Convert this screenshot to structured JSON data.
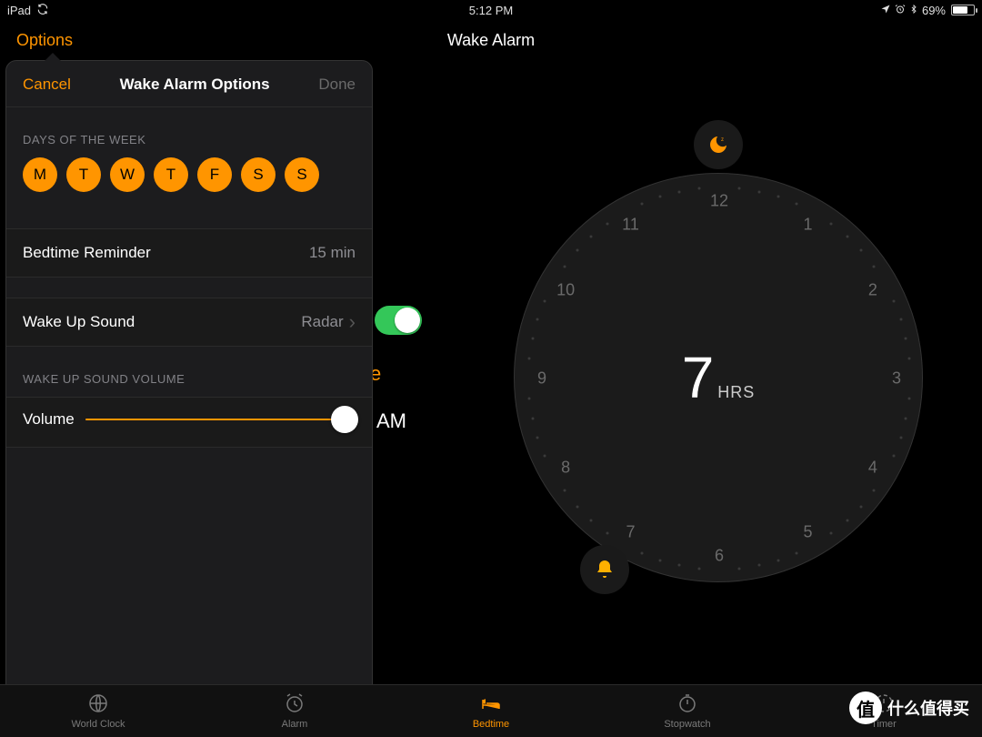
{
  "status": {
    "device": "iPad",
    "time": "5:12 PM",
    "battery_pct": "69%"
  },
  "nav": {
    "options": "Options",
    "title": "Wake Alarm"
  },
  "popover": {
    "cancel": "Cancel",
    "title": "Wake Alarm Options",
    "done": "Done",
    "days_label": "DAYS OF THE WEEK",
    "days": [
      "M",
      "T",
      "W",
      "T",
      "F",
      "S",
      "S"
    ],
    "bedtime_reminder_label": "Bedtime Reminder",
    "bedtime_reminder_value": "15 min",
    "wake_sound_label": "Wake Up Sound",
    "wake_sound_value": "Radar",
    "volume_section": "WAKE UP SOUND VOLUME",
    "volume_label": "Volume"
  },
  "dial": {
    "value": "7",
    "unit": "HRS",
    "hours": [
      "12",
      "1",
      "2",
      "3",
      "4",
      "5",
      "6",
      "7",
      "8",
      "9",
      "10",
      "11"
    ]
  },
  "peek": {
    "right_fragment": "ke",
    "am": "AM"
  },
  "tabs": [
    {
      "label": "World Clock"
    },
    {
      "label": "Alarm"
    },
    {
      "label": "Bedtime"
    },
    {
      "label": "Stopwatch"
    },
    {
      "label": "Timer"
    }
  ],
  "watermark": {
    "text": "什么值得买",
    "badge": "值"
  },
  "colors": {
    "accent": "#ff9500",
    "green": "#34c759"
  }
}
